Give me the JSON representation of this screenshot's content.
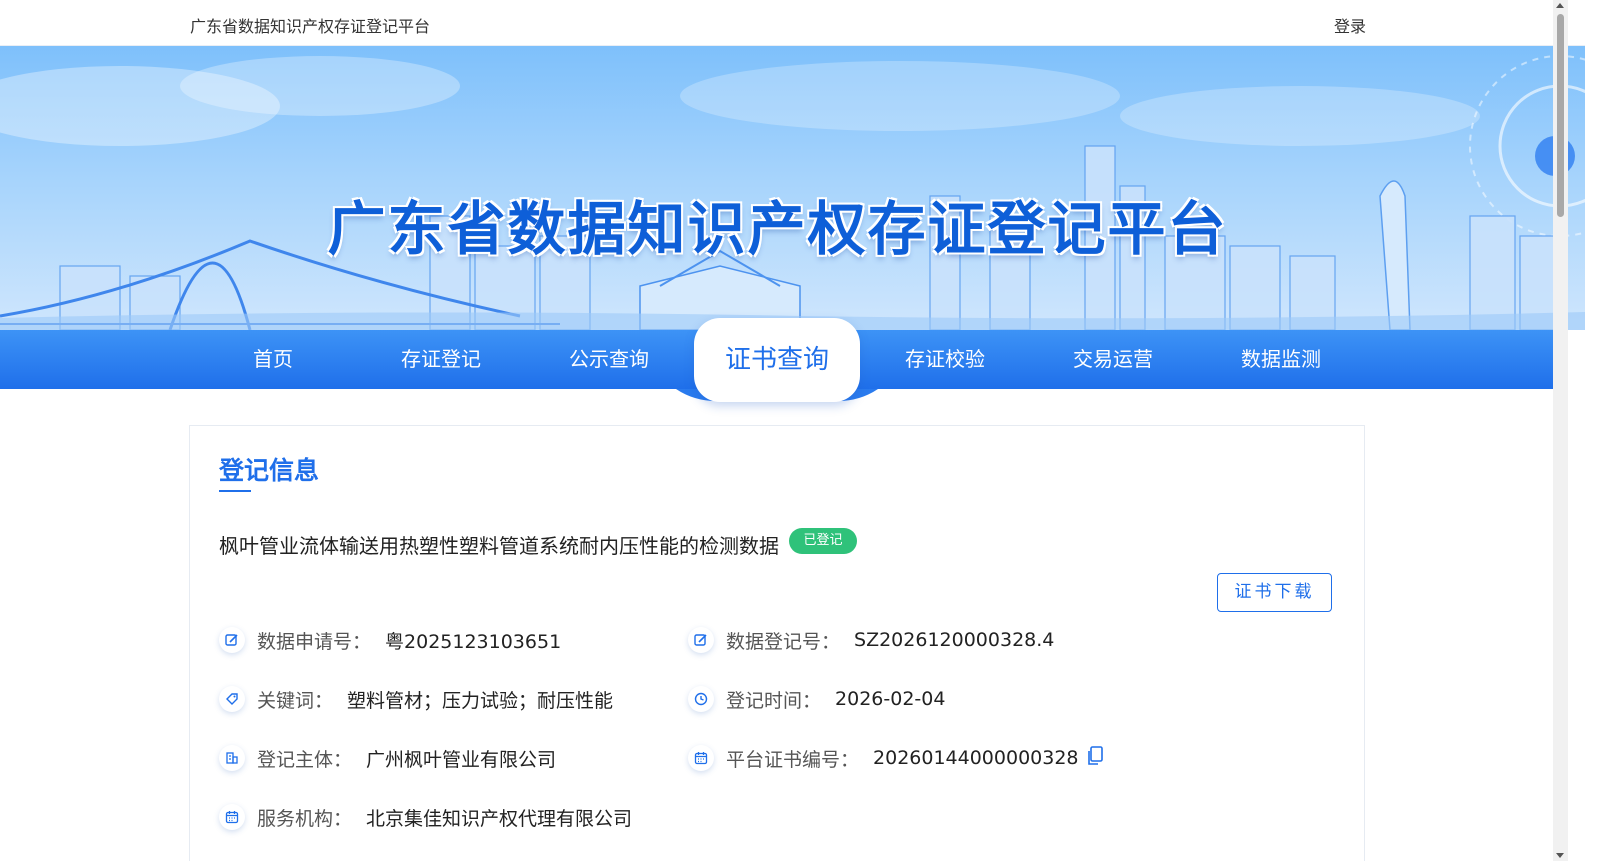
{
  "topbar": {
    "site_name": "广东省数据知识产权存证登记平台",
    "login_label": "登录"
  },
  "banner": {
    "title": "广东省数据知识产权存证登记平台"
  },
  "nav": {
    "items": [
      {
        "label": "首页"
      },
      {
        "label": "存证登记"
      },
      {
        "label": "公示查询"
      },
      {
        "label": "证书查询",
        "active": true
      },
      {
        "label": "存证校验"
      },
      {
        "label": "交易运营"
      },
      {
        "label": "数据监测"
      }
    ]
  },
  "section": {
    "title": "登记信息"
  },
  "record": {
    "title": "枫叶管业流体输送用热塑性塑料管道系统耐内压性能的检测数据",
    "status": "已登记",
    "download_label": "证书下载"
  },
  "fields": {
    "application_no": {
      "label": "数据申请号：",
      "value": "粤2025123103651",
      "icon": "edit-icon"
    },
    "registration_no": {
      "label": "数据登记号：",
      "value": "SZ2026120000328.4",
      "icon": "edit-icon"
    },
    "keywords": {
      "label": "关键词：",
      "value": "塑料管材；压力试验；耐压性能",
      "icon": "tag-icon"
    },
    "registration_time": {
      "label": "登记时间：",
      "value": "2026-02-04",
      "icon": "clock-icon"
    },
    "registrant": {
      "label": "登记主体：",
      "value": "广州枫叶管业有限公司",
      "icon": "building-icon"
    },
    "certificate_no": {
      "label": "平台证书编号：",
      "value": "20260144000000328",
      "icon": "calendar-icon"
    },
    "service_agency": {
      "label": "服务机构：",
      "value": "北京集佳知识产权代理有限公司",
      "icon": "calendar-icon"
    }
  },
  "colors": {
    "primary": "#1f6fea",
    "badge_green": "#2fc27a",
    "banner_sky": "#7ec0fb"
  }
}
